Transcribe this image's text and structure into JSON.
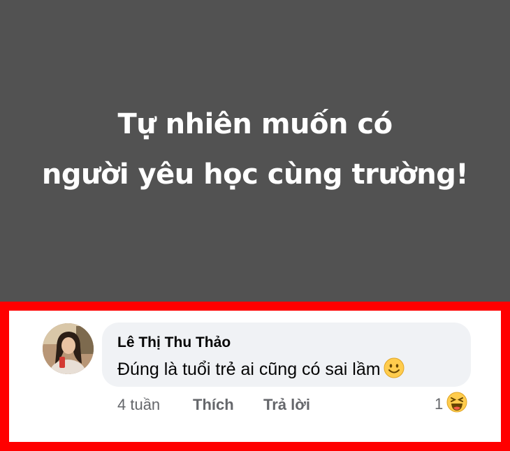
{
  "post": {
    "line1": "Tự nhiên muốn có",
    "line2": "người yêu học cùng trường!",
    "background_color": "#525252"
  },
  "comment": {
    "author": "Lê Thị Thu Thảo",
    "text": "Đúng là tuổi trẻ ai cũng có sai lầm",
    "emoji": "smiling-face-icon",
    "time": "4 tuần",
    "like_label": "Thích",
    "reply_label": "Trả lời",
    "reaction_count": "1",
    "reaction_icon": "haha-reaction-icon"
  },
  "highlight_color": "#ff0000"
}
